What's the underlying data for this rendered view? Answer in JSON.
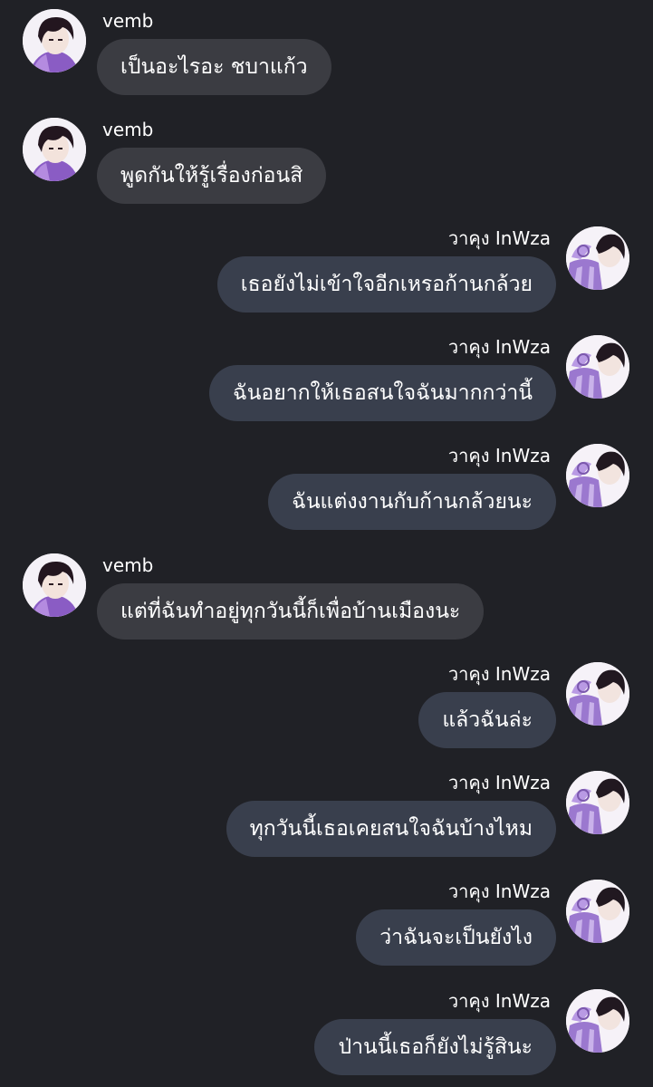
{
  "conversation": {
    "messages": [
      {
        "side": "left",
        "sender": "vemb",
        "text": "เป็นอะไรอะ ชบาแก้ว",
        "avatar_icon": "dark-haired-character-avatar-icon"
      },
      {
        "side": "left",
        "sender": "vemb",
        "text": "พูดกันให้รู้เรื่องก่อนสิ",
        "avatar_icon": "dark-haired-character-avatar-icon"
      },
      {
        "side": "right",
        "sender": "วาคุง InWza",
        "text": "เธอยังไม่เข้าใจอีกเหรอก้านกล้วย",
        "avatar_icon": "purple-character-avatar-icon"
      },
      {
        "side": "right",
        "sender": "วาคุง InWza",
        "text": "ฉันอยากให้เธอสนใจฉันมากกว่านี้",
        "avatar_icon": "purple-character-avatar-icon"
      },
      {
        "side": "right",
        "sender": "วาคุง InWza",
        "text": "ฉันแต่งงานกับก้านกล้วยนะ",
        "avatar_icon": "purple-character-avatar-icon"
      },
      {
        "side": "left",
        "sender": "vemb",
        "text": "แต่ที่ฉันทำอยู่ทุกวันนี้ก็เพื่อบ้านเมืองนะ",
        "avatar_icon": "dark-haired-character-avatar-icon"
      },
      {
        "side": "right",
        "sender": "วาคุง InWza",
        "text": "แล้วฉันล่ะ",
        "avatar_icon": "purple-character-avatar-icon"
      },
      {
        "side": "right",
        "sender": "วาคุง InWza",
        "text": "ทุกวันนี้เธอเคยสนใจฉันบ้างไหม",
        "avatar_icon": "purple-character-avatar-icon"
      },
      {
        "side": "right",
        "sender": "วาคุง InWza",
        "text": "ว่าฉันจะเป็นยังไง",
        "avatar_icon": "purple-character-avatar-icon"
      },
      {
        "side": "right",
        "sender": "วาคุง InWza",
        "text": "ป่านนี้เธอก็ยังไม่รู้สินะ",
        "avatar_icon": "purple-character-avatar-icon"
      }
    ]
  },
  "colors": {
    "background": "#202126",
    "incoming_bubble": "#3b3c42",
    "outgoing_bubble": "#393f4d",
    "text": "#ffffff"
  }
}
